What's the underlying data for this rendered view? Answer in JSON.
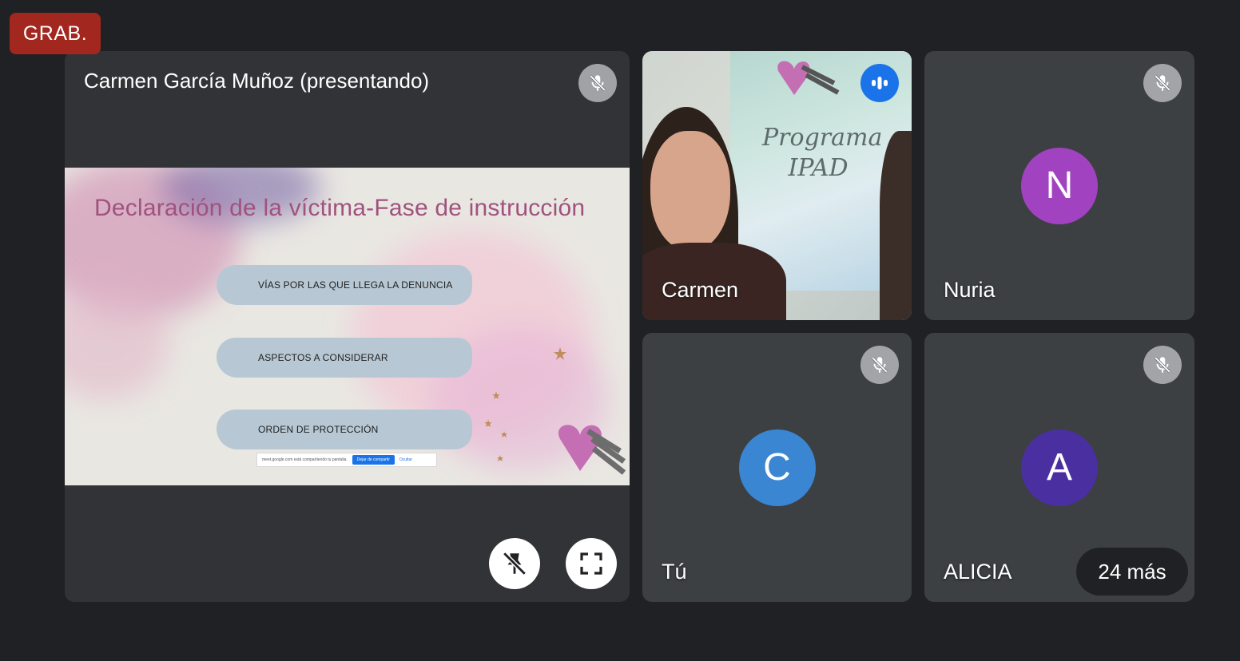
{
  "recording_badge": "GRAB.",
  "main_tile": {
    "presenter_label": "Carmen García Muñoz (presentando)",
    "slide": {
      "title": "Declaración de la víctima-Fase de instrucción",
      "items": [
        "VÍAS POR LAS QUE LLEGA LA DENUNCIA",
        "ASPECTOS A CONSIDERAR",
        "ORDEN DE PROTECCIÓN"
      ],
      "share_bar": {
        "message": "meet.google.com está compartiendo tu pantalla.",
        "stop_label": "Dejar de compartir",
        "hide_label": "Ocultar"
      }
    }
  },
  "participants": [
    {
      "name": "Carmen",
      "poster_text": "Programa IPAD",
      "speaking": true
    },
    {
      "name": "Nuria",
      "initial": "N",
      "avatar_color": "#a142c0"
    },
    {
      "name": "Tú",
      "initial": "C",
      "avatar_color": "#3a86d2"
    },
    {
      "name": "ALICIA",
      "initial": "A",
      "avatar_color": "#4a2fa1"
    }
  ],
  "more_participants": "24 más",
  "colors": {
    "background": "#202124",
    "tile": "#3c4043",
    "recording": "#a1271f",
    "speaking": "#1a73e8"
  },
  "icons": {
    "muted": "mic-off-icon",
    "speaking": "audio-level-icon",
    "unpin": "pin-off-icon",
    "fullscreen": "fullscreen-icon"
  }
}
